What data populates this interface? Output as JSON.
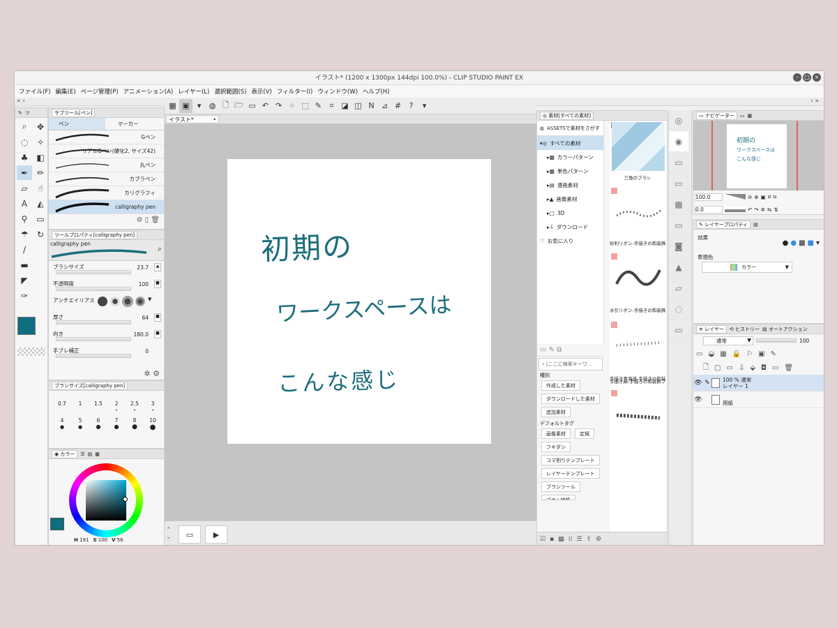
{
  "window": {
    "title": "イラスト* (1200 x 1300px 144dpi 100.0%) - CLIP STUDIO PAINT EX"
  },
  "menu": [
    "ファイル(F)",
    "編集(E)",
    "ページ管理(P)",
    "アニメーション(A)",
    "レイヤー(L)",
    "選択範囲(S)",
    "表示(V)",
    "フィルター(I)",
    "ウィンドウ(W)",
    "ヘルプ(H)"
  ],
  "left_panel": {
    "sub_tool_tab": "サブツール[ペン]",
    "tab_prefix": "ツ",
    "tabs": [
      "ペン",
      "マーカー"
    ],
    "brushes": [
      {
        "label": "Gペン"
      },
      {
        "label": "リアルGペン(硬化2, サイズ42)"
      },
      {
        "label": "丸ペン"
      },
      {
        "label": "カブラペン"
      },
      {
        "label": "カリグラフィ"
      },
      {
        "label": "calligraphy pen"
      }
    ],
    "tool_property_tab": "ツールプロパティ[calligraphy pen]",
    "preview_label": "calligraphy pen",
    "properties": [
      {
        "label": "ブラシサイズ",
        "value": "23.7"
      },
      {
        "label": "不透明度",
        "value": "100"
      },
      {
        "label": "アンチエイリアス",
        "value": ""
      },
      {
        "label": "厚さ",
        "value": "64"
      },
      {
        "label": "向き",
        "value": "180.0"
      },
      {
        "label": "手ブレ補正",
        "value": "0"
      }
    ],
    "brush_size_tab": "ブラシサイズ[calligraphy pen]",
    "brush_sizes": [
      "0.7",
      "1",
      "1.5",
      "2",
      "2.5",
      "3",
      "4",
      "5",
      "6",
      "7",
      "8",
      "10"
    ],
    "color_tab": "カラー",
    "color_readout": {
      "r_label": "H",
      "r": "191",
      "g_label": "S",
      "g": "100",
      "b_label": "V",
      "b": "56"
    },
    "main_color": "#0f6e80"
  },
  "canvas": {
    "tab": "イラスト*",
    "text_lines": [
      "初期の",
      "ワークスペースは",
      "こんな感じ"
    ],
    "ink_color": "#1d6e7c"
  },
  "materials": {
    "tab": "素材[すべての素材]",
    "assets_search": "ASSETSで素材をさがす",
    "tree": [
      "すべての素材",
      "カラーパターン",
      "単色パターン",
      "漫画素材",
      "画像素材",
      "3D",
      "ダウンロード",
      "お気に入り"
    ],
    "search_placeholder": "[ここに検索キーワ...",
    "kind_label": "種別",
    "kind_tags": [
      "作成した素材",
      "ダウンロードした素材",
      "追加素材"
    ],
    "default_tag_label": "デフォルトタグ",
    "default_tags": [
      "画像素材",
      "定規",
      "フキダシ",
      "コマ割りテンプレート",
      "レイヤーテンプレート",
      "ブラシツール",
      "ブラシ特性"
    ],
    "thumbnails": [
      "三角のブラシ",
      "砂利リボン-手描きの和装飾",
      "水引リボン-手描きの和装飾",
      "手描き青海波-手描きの和装",
      "手描き麻-手描きの和装飾ブ"
    ]
  },
  "navigator": {
    "tab": "ナビゲーター",
    "zoom": "100.0",
    "rotate": "0.0"
  },
  "layer_property": {
    "tab": "レイヤープロパティ",
    "effect_label": "効果",
    "color_label": "表現色",
    "color_mode": "カラー"
  },
  "layers": {
    "tabs": [
      "レイヤー",
      "ヒストリー",
      "オートアクション"
    ],
    "blend_mode": "通常",
    "opacity": "100",
    "rows": [
      {
        "line1": "100 % 通常",
        "line2": "レイヤー 1"
      },
      {
        "line1": "",
        "line2": "用紙"
      }
    ]
  },
  "colors": {
    "accent": "#0f6e80",
    "selection": "#cde0f2"
  }
}
